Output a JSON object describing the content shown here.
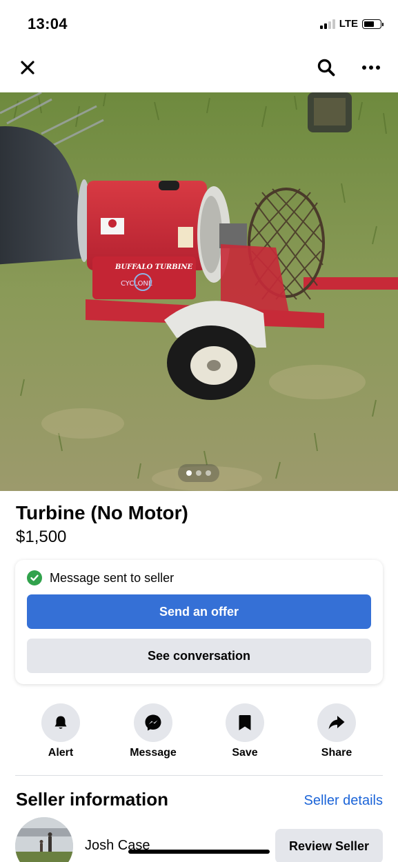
{
  "status_bar": {
    "time": "13:04",
    "network": "LTE"
  },
  "nav": {
    "close_icon": "close-icon",
    "search_icon": "search-icon",
    "more_icon": "more-icon"
  },
  "photo": {
    "description_icon": "listing-photo",
    "pager_total": 3,
    "pager_active": 1
  },
  "listing": {
    "title": "Turbine (No Motor)",
    "price": "$1,500"
  },
  "message_card": {
    "status_text": "Message sent to seller",
    "send_offer_label": "Send an offer",
    "see_conversation_label": "See conversation",
    "status_color": "#31a24c",
    "primary_color": "#3570d6"
  },
  "actions": [
    {
      "label": "Alert",
      "icon": "bell-icon"
    },
    {
      "label": "Message",
      "icon": "messenger-icon"
    },
    {
      "label": "Save",
      "icon": "bookmark-icon"
    },
    {
      "label": "Share",
      "icon": "share-icon"
    }
  ],
  "seller": {
    "heading": "Seller information",
    "details_link": "Seller details",
    "name": "Josh Case",
    "review_label": "Review Seller"
  }
}
